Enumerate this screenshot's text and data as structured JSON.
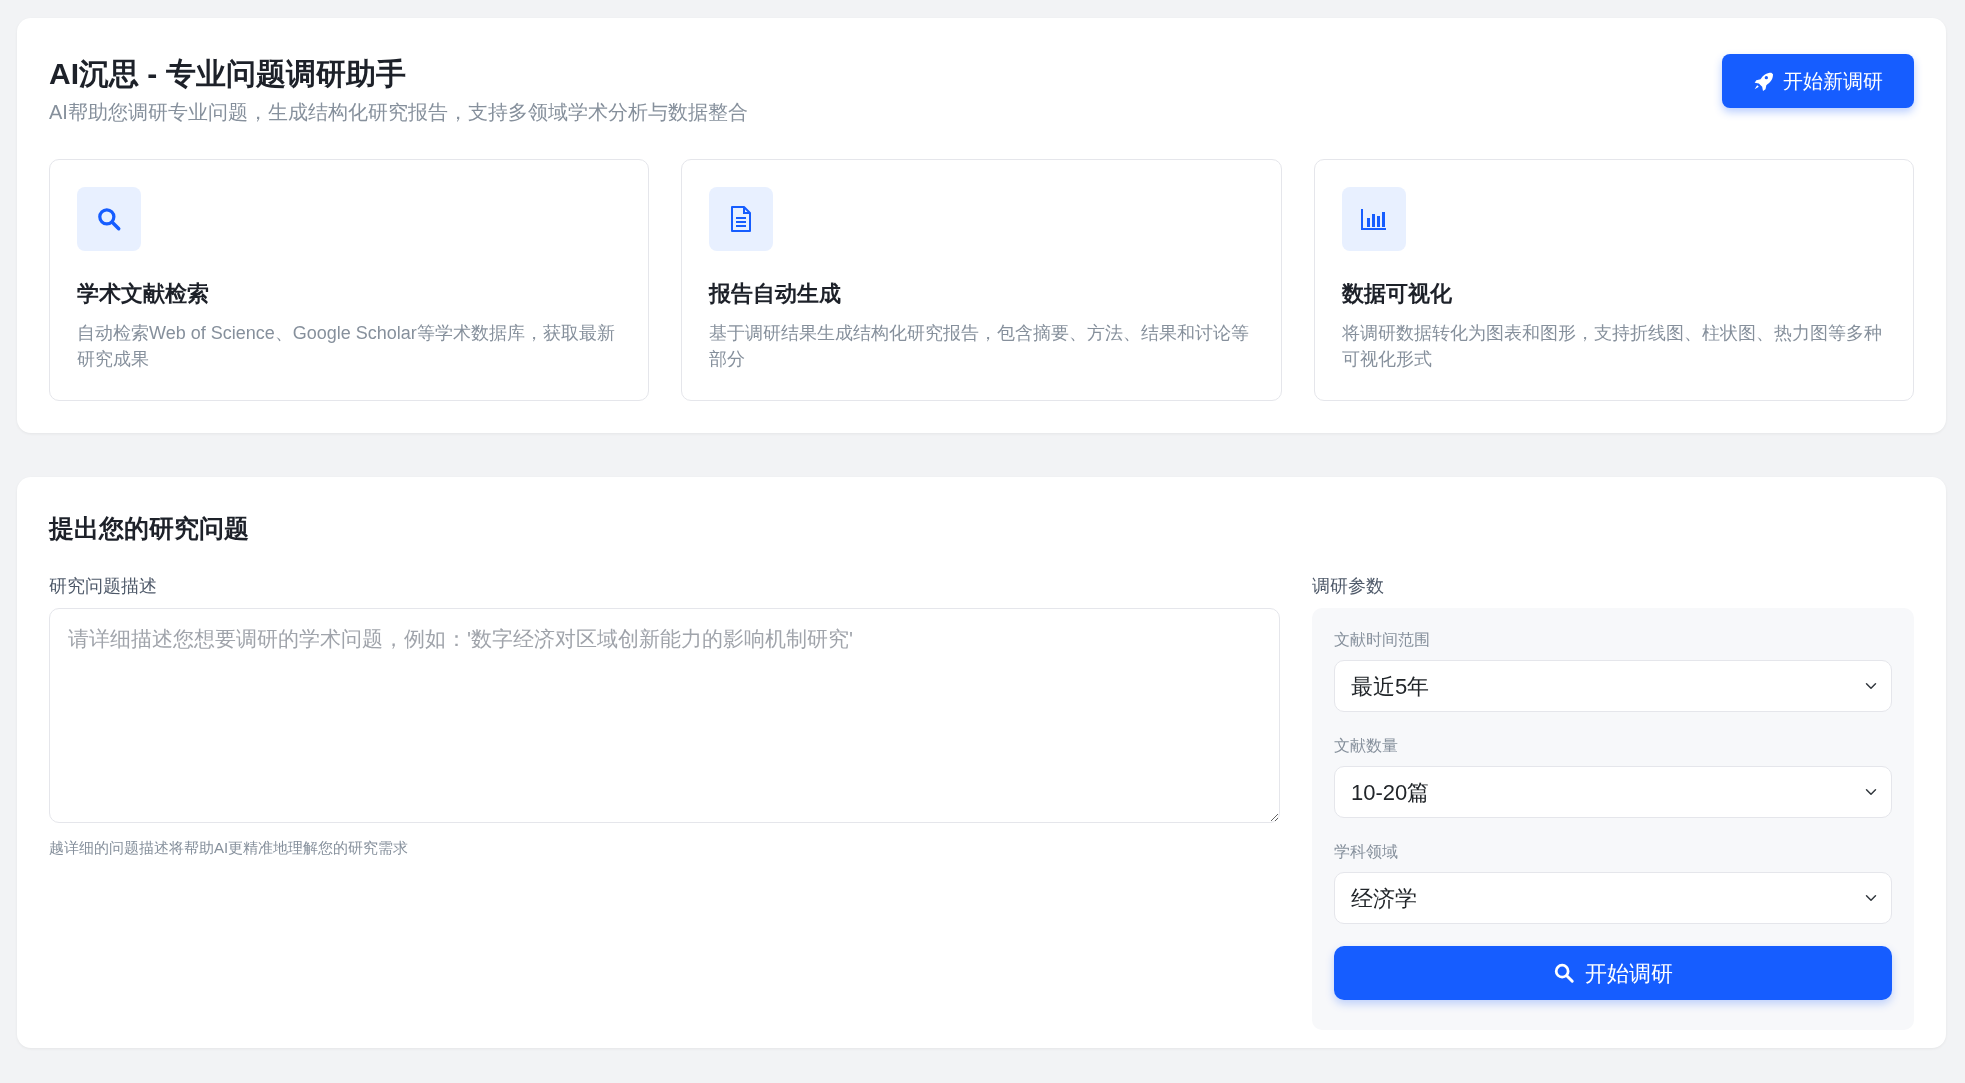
{
  "header": {
    "title": "AI沉思 - 专业问题调研助手",
    "subtitle": "AI帮助您调研专业问题，生成结构化研究报告，支持多领域学术分析与数据整合",
    "action_button": "开始新调研"
  },
  "features": [
    {
      "title": "学术文献检索",
      "description": "自动检索Web of Science、Google Scholar等学术数据库，获取最新研究成果"
    },
    {
      "title": "报告自动生成",
      "description": "基于调研结果生成结构化研究报告，包含摘要、方法、结果和讨论等部分"
    },
    {
      "title": "数据可视化",
      "description": "将调研数据转化为图表和图形，支持折线图、柱状图、热力图等多种可视化形式"
    }
  ],
  "form": {
    "title": "提出您的研究问题",
    "question_label": "研究问题描述",
    "question_placeholder": "请详细描述您想要调研的学术问题，例如：'数字经济对区域创新能力的影响机制研究'",
    "question_help": "越详细的问题描述将帮助AI更精准地理解您的研究需求",
    "params_label": "调研参数",
    "params": [
      {
        "label": "文献时间范围",
        "value": "最近5年"
      },
      {
        "label": "文献数量",
        "value": "10-20篇"
      },
      {
        "label": "学科领域",
        "value": "经济学"
      }
    ],
    "submit_button": "开始调研"
  }
}
